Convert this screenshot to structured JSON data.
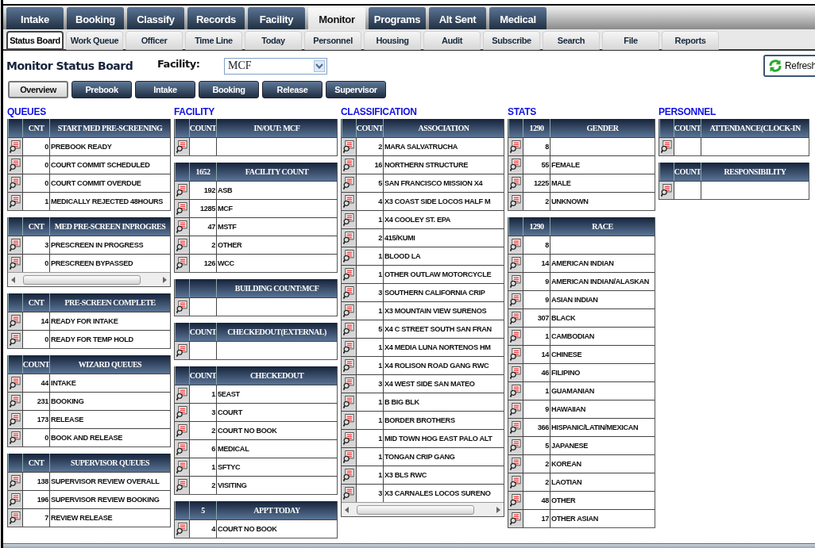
{
  "tabs": [
    {
      "label": "Intake",
      "selected": false
    },
    {
      "label": "Booking",
      "selected": false
    },
    {
      "label": "Classify",
      "selected": false
    },
    {
      "label": "Records",
      "selected": false
    },
    {
      "label": "Facility",
      "selected": false
    },
    {
      "label": "Monitor",
      "selected": true
    },
    {
      "label": "Programs",
      "selected": false
    },
    {
      "label": "Alt Sent",
      "selected": false
    },
    {
      "label": "Medical",
      "selected": false
    }
  ],
  "subtabs": [
    {
      "label": "Status Board",
      "selected": true
    },
    {
      "label": "Work Queue",
      "selected": false
    },
    {
      "label": "Officer",
      "selected": false
    },
    {
      "label": "Time Line",
      "selected": false
    },
    {
      "label": "Today",
      "selected": false
    },
    {
      "label": "Personnel",
      "selected": false
    },
    {
      "label": "Housing",
      "selected": false
    },
    {
      "label": "Audit",
      "selected": false
    },
    {
      "label": "Subscribe",
      "selected": false
    },
    {
      "label": "Search",
      "selected": false
    },
    {
      "label": "File",
      "selected": false
    },
    {
      "label": "Reports",
      "selected": false
    }
  ],
  "page_title": "Monitor Status Board",
  "facility": {
    "label": "Facility:",
    "value": "MCF"
  },
  "refresh_button": "Refresh",
  "view_buttons": [
    {
      "label": "Overview",
      "selected": true
    },
    {
      "label": "Prebook",
      "selected": false
    },
    {
      "label": "Intake",
      "selected": false
    },
    {
      "label": "Booking",
      "selected": false
    },
    {
      "label": "Release",
      "selected": false
    },
    {
      "label": "Supervisor",
      "selected": false
    }
  ],
  "sections": [
    {
      "title": "QUEUES",
      "tables": [
        {
          "count_header": "CNT",
          "name_header": "START MED PRE-SCREENING",
          "rows": [
            {
              "count": "0",
              "name": "PREBOOK READY"
            },
            {
              "count": "0",
              "name": "COURT COMMIT SCHEDULED"
            },
            {
              "count": "0",
              "name": "COURT COMMIT OVERDUE"
            },
            {
              "count": "1",
              "name": "MEDICALLY REJECTED 48HOURS"
            }
          ]
        },
        {
          "count_header": "CNT",
          "name_header": "MED PRE-SCREEN INPROGRES",
          "scrollbar": true,
          "rows": [
            {
              "count": "3",
              "name": "PRESCREEN IN PROGRESS"
            },
            {
              "count": "0",
              "name": "PRESCREEN BYPASSED"
            }
          ]
        },
        {
          "count_header": "CNT",
          "name_header": "PRE-SCREEN COMPLETE",
          "rows": [
            {
              "count": "14",
              "name": "READY FOR INTAKE"
            },
            {
              "count": "0",
              "name": "READY FOR TEMP HOLD"
            }
          ]
        },
        {
          "count_header": "COUNT",
          "name_header": "WIZARD QUEUES",
          "rows": [
            {
              "count": "44",
              "name": "INTAKE"
            },
            {
              "count": "231",
              "name": "BOOKING"
            },
            {
              "count": "173",
              "name": "RELEASE"
            },
            {
              "count": "0",
              "name": "BOOK AND RELEASE"
            }
          ]
        },
        {
          "count_header": "CNT",
          "name_header": "SUPERVISOR QUEUES",
          "rows": [
            {
              "count": "138",
              "name": "SUPERVISOR REVIEW OVERALL"
            },
            {
              "count": "196",
              "name": "SUPERVISOR REVIEW BOOKING"
            },
            {
              "count": "7",
              "name": "REVIEW RELEASE"
            }
          ]
        }
      ]
    },
    {
      "title": "FACILITY",
      "tables": [
        {
          "count_header": "COUNT",
          "name_header": "IN/OUT: MCF",
          "rows": [
            {}
          ]
        },
        {
          "count_header": "1652",
          "name_header": "FACILITY COUNT",
          "rows": [
            {
              "count": "192",
              "name": "ASB"
            },
            {
              "count": "1285",
              "name": "MCF"
            },
            {
              "count": "47",
              "name": "MSTF"
            },
            {
              "count": "2",
              "name": "OTHER"
            },
            {
              "count": "126",
              "name": "WCC"
            }
          ]
        },
        {
          "name_header": "BUILDING COUNT:MCF",
          "rows": [
            {}
          ]
        },
        {
          "count_header": "COUNT",
          "name_header": "CHECKEDOUT(EXTERNAL)",
          "rows": [
            {}
          ]
        },
        {
          "count_header": "COUNT",
          "name_header": "CHECKEDOUT",
          "rows": [
            {
              "count": "1",
              "name": "5EAST"
            },
            {
              "count": "3",
              "name": "COURT"
            },
            {
              "count": "2",
              "name": "COURT NO BOOK"
            },
            {
              "count": "6",
              "name": "MEDICAL"
            },
            {
              "count": "1",
              "name": "SFTYC"
            },
            {
              "count": "2",
              "name": "VISITING"
            }
          ]
        },
        {
          "count_header": "5",
          "name_header": "APPT TODAY",
          "rows": [
            {
              "count": "4",
              "name": "COURT NO BOOK"
            }
          ]
        }
      ]
    },
    {
      "title": "CLASSIFICATION",
      "tables": [
        {
          "count_header": "COUNT",
          "name_header": "ASSOCIATION",
          "scrollbar": true,
          "rows": [
            {
              "count": "2",
              "name": "MARA SALVATRUCHA"
            },
            {
              "count": "16",
              "name": "NORTHERN STRUCTURE"
            },
            {
              "count": "5",
              "name": "SAN FRANCISCO MISSION X4"
            },
            {
              "count": "4",
              "name": "X3 COAST SIDE LOCOS HALF M"
            },
            {
              "count": "1",
              "name": "X4 COOLEY ST. EPA"
            },
            {
              "count": "2",
              "name": "415/KUMI"
            },
            {
              "count": "1",
              "name": "BLOOD LA"
            },
            {
              "count": "1",
              "name": "OTHER OUTLAW MOTORCYCLE"
            },
            {
              "count": "3",
              "name": "SOUTHERN CALIFORNIA CRIP"
            },
            {
              "count": "1",
              "name": "X3 MOUNTAIN VIEW SURENOS"
            },
            {
              "count": "5",
              "name": "X4 C STREET SOUTH SAN FRAN"
            },
            {
              "count": "1",
              "name": "X4 MEDIA LUNA NORTENOS HM"
            },
            {
              "count": "1",
              "name": "X4 ROLISON ROAD GANG RWC"
            },
            {
              "count": "3",
              "name": "X4 WEST SIDE SAN MATEO"
            },
            {
              "count": "1",
              "name": "B BIG BLK"
            },
            {
              "count": "1",
              "name": "BORDER BROTHERS"
            },
            {
              "count": "1",
              "name": "MID TOWN HOG EAST PALO ALT"
            },
            {
              "count": "1",
              "name": "TONGAN CRIP GANG"
            },
            {
              "count": "1",
              "name": "X3 BLS RWC"
            },
            {
              "count": "3",
              "name": "X3 CARNALES LOCOS SURENO"
            }
          ]
        }
      ]
    },
    {
      "title": "STATS",
      "tables": [
        {
          "count_header": "1290",
          "name_header": "GENDER",
          "rows": [
            {
              "count": "8"
            },
            {
              "count": "55",
              "name": "FEMALE"
            },
            {
              "count": "1225",
              "name": "MALE"
            },
            {
              "count": "2",
              "name": "UNKNOWN"
            }
          ]
        },
        {
          "count_header": "1290",
          "name_header": "RACE",
          "rows": [
            {
              "count": "8"
            },
            {
              "count": "14",
              "name": "AMERICAN INDIAN"
            },
            {
              "count": "9",
              "name": "AMERICAN INDIAN/ALASKAN"
            },
            {
              "count": "9",
              "name": "ASIAN INDIAN"
            },
            {
              "count": "307",
              "name": "BLACK"
            },
            {
              "count": "1",
              "name": "CAMBODIAN"
            },
            {
              "count": "14",
              "name": "CHINESE"
            },
            {
              "count": "46",
              "name": "FILIPINO"
            },
            {
              "count": "1",
              "name": "GUAMANIAN"
            },
            {
              "count": "9",
              "name": "HAWAIIAN"
            },
            {
              "count": "366",
              "name": "HISPANIC/LATIN/MEXICAN"
            },
            {
              "count": "5",
              "name": "JAPANESE"
            },
            {
              "count": "2",
              "name": "KOREAN"
            },
            {
              "count": "2",
              "name": "LAOTIAN"
            },
            {
              "count": "48",
              "name": "OTHER"
            },
            {
              "count": "17",
              "name": "OTHER ASIAN"
            }
          ]
        }
      ]
    },
    {
      "title": "PERSONNEL",
      "tables": [
        {
          "count_header": "COUNT",
          "name_header": "ATTENDANCE(CLOCK-IN",
          "rows": [
            {}
          ]
        },
        {
          "count_header": "COUNT",
          "name_header": "RESPONSIBILITY",
          "rows": [
            {}
          ]
        }
      ]
    }
  ]
}
